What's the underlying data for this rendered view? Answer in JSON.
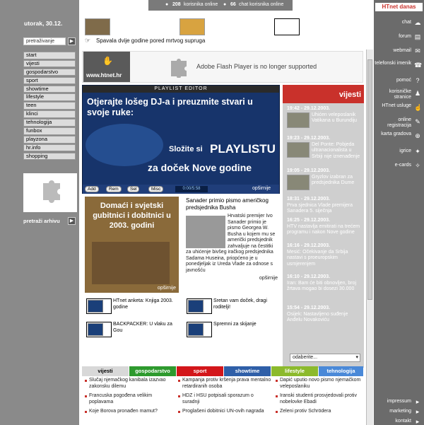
{
  "left": {
    "date": "utorak, 30.12.",
    "search_value": "pretraživanje",
    "go_label": "▶",
    "nav": [
      "start",
      "vijesti",
      "gospodarstvo",
      "sport",
      "showtime",
      "lifestyle",
      "teen",
      "klinci",
      "tehnologija",
      "funbox",
      "playzona",
      "hr.info",
      "shopping"
    ],
    "archive_label": "pretraži arhivu"
  },
  "topbar": {
    "users_count": "208",
    "users_label": "korisnika online",
    "chat_count": "66",
    "chat_label": "chat korisnika online"
  },
  "caption": "Spavala dvije godine pored mrtvog supruga",
  "banner": {
    "logo_text": "www.htnet.hr",
    "flash_text": "Adobe Flash Player is no longer supported"
  },
  "player": {
    "title": "PLAYLIST EDITOR",
    "headline": "Otjerajte lošeg DJ-a i preuzmite stvari u svoje ruke:",
    "cta1": "Složite si",
    "cta2": "PLAYLISTU",
    "cta3": "za doček Nove godine",
    "btn_add": "Add",
    "btn_rem": "Rem",
    "btn_sel": "Sel",
    "btn_misc": "Misc",
    "time": "0:00/5:58",
    "more": "opširnije"
  },
  "promo": {
    "text": "Domaći i svjetski gubitnici i dobitnici u 2003. godini",
    "more": "opširnije"
  },
  "story": {
    "headline": "Sanader primio pismo američkog predsjednika Busha",
    "body": "Hrvatski premijer Ivo Sanader primio je pismo Georgea W. Busha u kojem mu se američki predsjednik zahvaljuje na čestitki za uhićenje bivšeg iračkog predsjednika Sadama Huseina, priopćeno je u ponedjeljak iz Ureda Vlade za odnose s javnošću",
    "more": "opširnije"
  },
  "links": [
    "HTnet anketa: Knjiga 2003. godine",
    "Sretan vam doček, dragi roditelji!",
    "BACKPACKER: U vlaku za Gou",
    "Spremni za skijanje"
  ],
  "news": {
    "head": "vijesti",
    "items": [
      {
        "time": "19:42 - 29.12.2003.",
        "text": "Uhićen veleposlanik Vatikana u Burundiju"
      },
      {
        "time": "19:23 - 29.12.2003.",
        "text": "Del Ponte: Pobjeda ultranacionalista u Srbiji nije iznenađenje"
      },
      {
        "time": "19:05 - 29.12.2003.",
        "text": "Gryzlov izabran za predsjednika Dume"
      },
      {
        "time": "18:31 - 29.12.2003.",
        "text": "Prva sjednica Vlade premijera Sanadera 5. siječnja"
      },
      {
        "time": "16:25 - 29.12.2003.",
        "text": "HTV nastavlja emitirati na trećem programu i nakon Nove godine"
      },
      {
        "time": "16:16 - 29.12.2003.",
        "text": "Mesić: Očekivanje da Srbija nastavi s proeuropskim usmjerenjem"
      },
      {
        "time": "16:10 - 29.12.2003.",
        "text": "Iran: Bam će biti obnovljen, broj žrtava mogao bi dosezi 30.000"
      },
      {
        "time": "15:54 - 29.12.2003.",
        "text": "Osijek: Nastavljeno suđenje Anđelu Novakoviću"
      }
    ],
    "select_value": "odaberite..."
  },
  "right": {
    "brand": "HTnet danas",
    "items": [
      "chat",
      "forum",
      "webmail",
      "telefonski imenik",
      "pomoć",
      "korisničke stranice",
      "HTnet usluge",
      "online registracija",
      "karta gradova",
      "igrice",
      "e-cards",
      "impressum",
      "marketing",
      "kontakt"
    ],
    "icons": [
      "chat-icon",
      "forum-icon",
      "mail-icon",
      "phone-icon",
      "help-icon",
      "user-pages-icon",
      "services-icon",
      "register-icon",
      "map-icon",
      "games-icon",
      "ecards-icon",
      "impressum-icon",
      "marketing-icon",
      "contact-icon"
    ]
  },
  "tabs": [
    {
      "label": "vijesti",
      "color": "#d8d8d8",
      "fg": "#000000"
    },
    {
      "label": "gospodarstvo",
      "color": "#2e9a2e",
      "fg": "#ffffff"
    },
    {
      "label": "sport",
      "color": "#d3161a",
      "fg": "#ffffff"
    },
    {
      "label": "showtime",
      "color": "#2f5fa8",
      "fg": "#ffffff"
    },
    {
      "label": "lifestyle",
      "color": "#8cba2c",
      "fg": "#ffffff"
    },
    {
      "label": "tehnologija",
      "color": "#4a89d8",
      "fg": "#ffffff"
    }
  ],
  "bottom_news": {
    "col1": [
      "Slučaj njemačkog kanibala izazvao zakonsku dilemu",
      "Francuska pogođena velikim poplavama",
      "Koje Borova pronađen mamut?"
    ],
    "col2": [
      "Kampanja protiv kršenja prava mentalno retardiranih osoba",
      "HDZ i HSU potpisali sporazum o suradnji",
      "Proglašeni dobitnici UN-ovih nagrada"
    ],
    "col3": [
      "Dapić uputio novo pismo njemačkom veleposlaniku",
      "Iranski studenti prosvjedovali protiv nobelovke Ebadi",
      "Zeleni protiv Schrödera"
    ]
  }
}
